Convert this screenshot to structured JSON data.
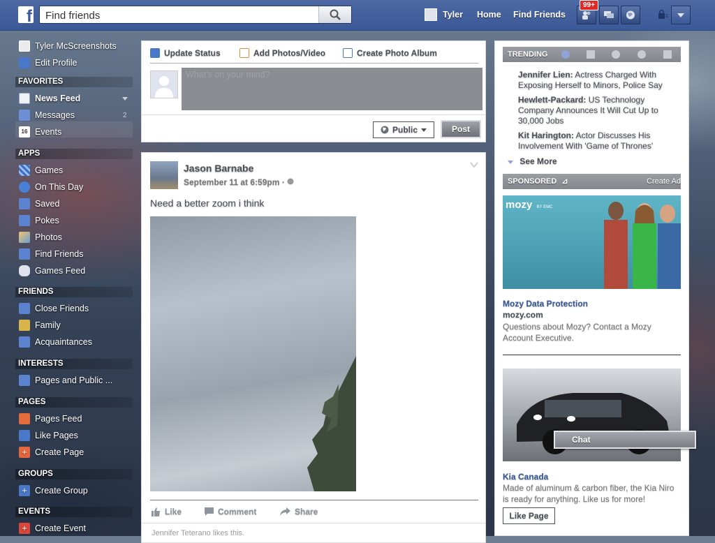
{
  "topbar": {
    "search_placeholder": "Find friends",
    "user_name": "Tyler",
    "home": "Home",
    "find_friends": "Find Friends",
    "notification_badge": "99+"
  },
  "sidebar": {
    "profile": [
      {
        "label": "Tyler McScreenshots",
        "icon": "profile-icon"
      },
      {
        "label": "Edit Profile",
        "icon": "pencil-icon"
      }
    ],
    "sections": [
      {
        "title": "FAVORITES",
        "items": [
          {
            "label": "News Feed",
            "icon": "news-feed-icon",
            "count": ""
          },
          {
            "label": "Messages",
            "icon": "messages-icon",
            "count": "2"
          },
          {
            "label": "Events",
            "icon": "calendar-icon",
            "count": ""
          }
        ]
      },
      {
        "title": "APPS",
        "items": [
          {
            "label": "Games",
            "icon": "games-icon"
          },
          {
            "label": "On This Day",
            "icon": "clock-icon"
          },
          {
            "label": "Saved",
            "icon": "bookmark-icon"
          },
          {
            "label": "Pokes",
            "icon": "poke-icon"
          },
          {
            "label": "Photos",
            "icon": "photos-icon"
          },
          {
            "label": "Find Friends",
            "icon": "find-friends-icon"
          },
          {
            "label": "Games Feed",
            "icon": "gamepad-icon"
          }
        ]
      },
      {
        "title": "FRIENDS",
        "items": [
          {
            "label": "Close Friends",
            "icon": "star-icon"
          },
          {
            "label": "Family",
            "icon": "house-icon"
          },
          {
            "label": "Acquaintances",
            "icon": "friends-list-icon"
          }
        ]
      },
      {
        "title": "INTERESTS",
        "items": [
          {
            "label": "Pages and Public ...",
            "icon": "rss-icon"
          }
        ]
      },
      {
        "title": "PAGES",
        "items": [
          {
            "label": "Pages Feed",
            "icon": "flag-icon"
          },
          {
            "label": "Like Pages",
            "icon": "thumbs-up-icon"
          },
          {
            "label": "Create Page",
            "icon": "plus-icon"
          }
        ]
      },
      {
        "title": "GROUPS",
        "items": [
          {
            "label": "Create Group",
            "icon": "plus-icon"
          }
        ]
      },
      {
        "title": "EVENTS",
        "items": [
          {
            "label": "Create Event",
            "icon": "plus-icon"
          }
        ]
      }
    ]
  },
  "composer": {
    "tabs": [
      "Update Status",
      "Add Photos/Video",
      "Create Photo Album"
    ],
    "placeholder": "What's on your mind?",
    "privacy": "Public",
    "post_label": "Post"
  },
  "story": {
    "author": "Jason Barnabe",
    "timestamp": "September 11 at 6:59pm",
    "meta_sep": "·",
    "text": "Need a better zoom i think",
    "actions": [
      "Like",
      "Comment",
      "Share"
    ],
    "likes": "Jennifer Teterano likes this."
  },
  "trending": {
    "title": "TRENDING",
    "items": [
      {
        "name": "Jennifer Lien:",
        "desc": " Actress Charged With Exposing Herself to Minors, Police Say"
      },
      {
        "name": "Hewlett-Packard:",
        "desc": " US Technology Company Announces It Will Cut Up to 30,000 Jobs"
      },
      {
        "name": "Kit Harington:",
        "desc": " Actor Discusses His Involvement With 'Game of Thrones'"
      }
    ],
    "see_more": "See More"
  },
  "sponsored": {
    "title": "SPONSORED",
    "create_ad": "Create Ad",
    "ads": [
      {
        "logo": "mozy",
        "logo_sub": "BY EMC",
        "title": "Mozy Data Protection",
        "url": "mozy.com",
        "desc": "Questions about Mozy? Contact a Mozy Account Executive."
      },
      {
        "title": "Kia Canada",
        "desc": "Made of aluminum & carbon fiber, the Kia Niro is ready for anything. Like us for more!",
        "cta": "Like Page"
      }
    ]
  },
  "chat": {
    "label": "Chat"
  },
  "colors": {
    "brand": "#3b5998",
    "link": "#365899",
    "badge": "#e02a2a"
  }
}
